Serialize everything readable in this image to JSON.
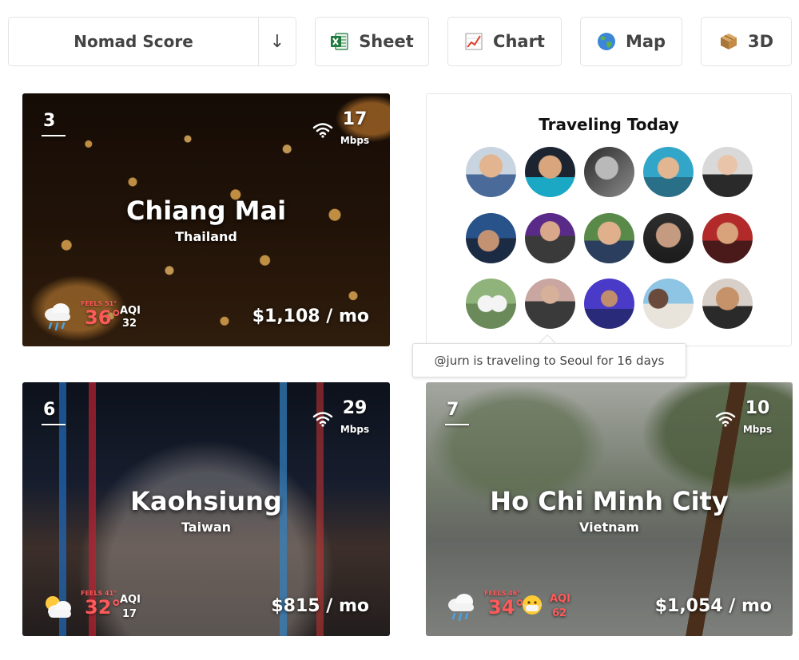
{
  "toolbar": {
    "sort_label": "Nomad Score",
    "sort_dir_symbol": "↓",
    "sheet_label": "Sheet",
    "chart_label": "Chart",
    "map_label": "Map",
    "threed_label": "3D",
    "icons": [
      "excel-icon",
      "chart-icon",
      "globe-icon",
      "box-icon"
    ]
  },
  "cities": [
    {
      "rank": "3",
      "mbps": "17",
      "mbps_unit": "Mbps",
      "name": "Chiang Mai",
      "country": "Thailand",
      "feels": "FEELS 51°",
      "temp": "36°",
      "aqi_label": "AQI",
      "aqi": "32",
      "cost": "$1,108 / mo",
      "weather_icon": "rain-cloud-icon"
    },
    {
      "rank": "6",
      "mbps": "29",
      "mbps_unit": "Mbps",
      "name": "Kaohsiung",
      "country": "Taiwan",
      "feels": "FEELS 41°",
      "temp": "32°",
      "aqi_label": "AQI",
      "aqi": "17",
      "cost": "$815 / mo",
      "weather_icon": "sun-cloud-icon"
    },
    {
      "rank": "7",
      "mbps": "10",
      "mbps_unit": "Mbps",
      "name": "Ho Chi Minh City",
      "country": "Vietnam",
      "feels": "FEELS 46°",
      "temp": "34°",
      "aqi_label": "AQI",
      "aqi": "62",
      "cost": "$1,054 / mo",
      "weather_icon": "rain-cloud-icon",
      "aqi_icon": "mask-face-icon"
    }
  ],
  "traveling": {
    "title": "Traveling Today",
    "tooltip": "@jurn is traveling to Seoul for 16 days"
  },
  "colors": {
    "temp": "#ff5a5a",
    "border": "#e3e3e3"
  }
}
